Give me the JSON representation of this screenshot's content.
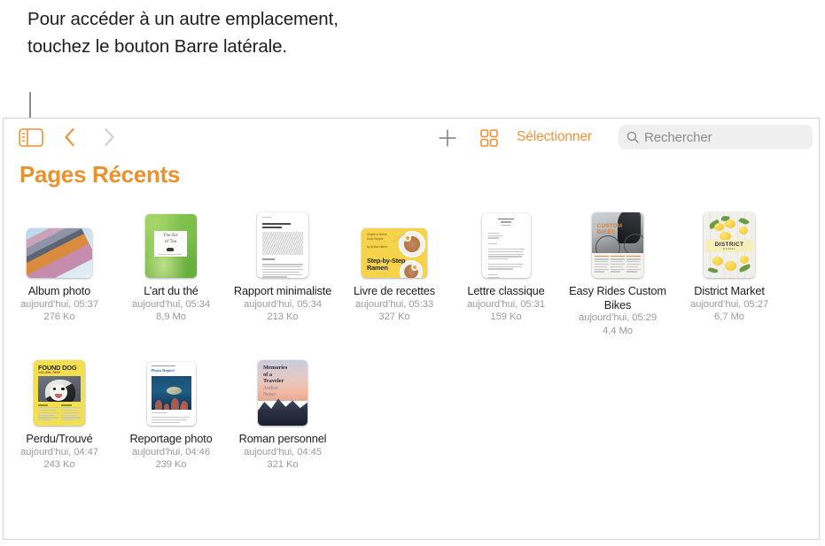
{
  "callout": {
    "text": "Pour accéder à un autre emplacement, touchez le bouton Barre latérale."
  },
  "toolbar": {
    "sidebar_icon": "sidebar-icon",
    "back_icon": "chevron-left-icon",
    "forward_icon": "chevron-right-icon",
    "add_icon": "plus-icon",
    "grid_icon": "grid-view-icon",
    "select_label": "Sélectionner",
    "search_icon": "search-icon",
    "search_placeholder": "Rechercher",
    "search_value": ""
  },
  "colors": {
    "accent": "#ef9136",
    "title": "#e8912d",
    "inactive": "#c8c8c8",
    "search_bg": "#efefef",
    "secondary_text": "#9a9a9a"
  },
  "page_title": "Pages Récents",
  "documents": [
    {
      "name": "Album photo",
      "date": "aujourd’hui, 05:37",
      "size": "276 Ko",
      "thumb": "album-photo-thumbnail"
    },
    {
      "name": "L’art du thé",
      "date": "aujourd’hui, 05:34",
      "size": "8,9 Mo",
      "thumb": "art-of-tea-thumbnail",
      "art": {
        "line1": "The Art",
        "line2": "of Tea"
      }
    },
    {
      "name": "Rapport minimaliste",
      "date": "aujourd’hui, 05:34",
      "size": "213 Ko",
      "thumb": "minimal-report-thumbnail"
    },
    {
      "name": "Livre de recettes",
      "date": "aujourd’hui, 05:33",
      "size": "327 Ko",
      "thumb": "recipe-book-thumbnail",
      "art": {
        "title": "Step-by-Step\nRamen"
      }
    },
    {
      "name": "Lettre classique",
      "date": "aujourd’hui, 05:31",
      "size": "159 Ko",
      "thumb": "classic-letter-thumbnail"
    },
    {
      "name": "Easy Rides Custom Bikes",
      "date": "aujourd’hui, 05:29",
      "size": "4,4 Mo",
      "thumb": "easy-rides-thumbnail",
      "art": {
        "title": "CUSTOM\nBIKES"
      }
    },
    {
      "name": "District Market",
      "date": "aujourd’hui, 05:27",
      "size": "6,7 Mo",
      "thumb": "district-market-thumbnail",
      "art": {
        "title": "DISTRICT",
        "subtitle": "MARKET"
      }
    },
    {
      "name": "Perdu/Trouvé",
      "date": "aujourd’hui, 04:47",
      "size": "243 Ko",
      "thumb": "found-dog-thumbnail",
      "art": {
        "title": "FOUND DOG",
        "phone": "123-456-7899"
      }
    },
    {
      "name": "Reportage photo",
      "date": "aujourd’hui, 04:46",
      "size": "239 Ko",
      "thumb": "photo-report-thumbnail",
      "art": {
        "title": "Photo Report"
      }
    },
    {
      "name": "Roman personnel",
      "date": "aujourd’hui, 04:45",
      "size": "321 Ko",
      "thumb": "personal-novel-thumbnail",
      "art": {
        "title": "Memories\nof a\nTraveler",
        "author": "Author\nName"
      }
    }
  ]
}
